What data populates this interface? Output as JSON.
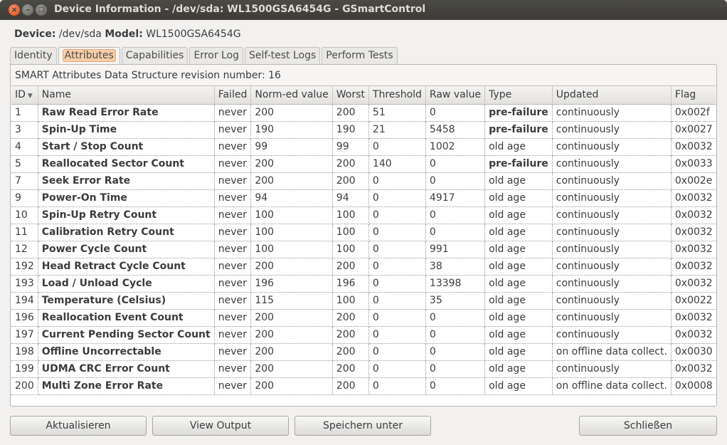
{
  "window": {
    "title": "Device Information - /dev/sda: WL1500GSA6454G - GSmartControl"
  },
  "device_line": {
    "device_label": "Device:",
    "device_value": "/dev/sda",
    "model_label": "Model:",
    "model_value": "WL1500GSA6454G"
  },
  "tabs": [
    {
      "label": "Identity",
      "active": false
    },
    {
      "label": "Attributes",
      "active": true
    },
    {
      "label": "Capabilities",
      "active": false
    },
    {
      "label": "Error Log",
      "active": false
    },
    {
      "label": "Self-test Logs",
      "active": false
    },
    {
      "label": "Perform Tests",
      "active": false
    }
  ],
  "revision_text": "SMART Attributes Data Structure revision number: 16",
  "table": {
    "columns": [
      "ID",
      "Name",
      "Failed",
      "Norm-ed value",
      "Worst",
      "Threshold",
      "Raw value",
      "Type",
      "Updated",
      "Flag"
    ],
    "rows": [
      [
        "1",
        "Raw Read Error Rate",
        "never",
        "200",
        "200",
        "51",
        "0",
        "pre-failure",
        "continuously",
        "0x002f"
      ],
      [
        "3",
        "Spin-Up Time",
        "never",
        "190",
        "190",
        "21",
        "5458",
        "pre-failure",
        "continuously",
        "0x0027"
      ],
      [
        "4",
        "Start / Stop Count",
        "never",
        "99",
        "99",
        "0",
        "1002",
        "old age",
        "continuously",
        "0x0032"
      ],
      [
        "5",
        "Reallocated Sector Count",
        "never",
        "200",
        "200",
        "140",
        "0",
        "pre-failure",
        "continuously",
        "0x0033"
      ],
      [
        "7",
        "Seek Error Rate",
        "never",
        "200",
        "200",
        "0",
        "0",
        "old age",
        "continuously",
        "0x002e"
      ],
      [
        "9",
        "Power-On Time",
        "never",
        "94",
        "94",
        "0",
        "4917",
        "old age",
        "continuously",
        "0x0032"
      ],
      [
        "10",
        "Spin-Up Retry Count",
        "never",
        "100",
        "100",
        "0",
        "0",
        "old age",
        "continuously",
        "0x0032"
      ],
      [
        "11",
        "Calibration Retry Count",
        "never",
        "100",
        "100",
        "0",
        "0",
        "old age",
        "continuously",
        "0x0032"
      ],
      [
        "12",
        "Power Cycle Count",
        "never",
        "100",
        "100",
        "0",
        "991",
        "old age",
        "continuously",
        "0x0032"
      ],
      [
        "192",
        "Head Retract Cycle Count",
        "never",
        "200",
        "200",
        "0",
        "38",
        "old age",
        "continuously",
        "0x0032"
      ],
      [
        "193",
        "Load / Unload Cycle",
        "never",
        "196",
        "196",
        "0",
        "13398",
        "old age",
        "continuously",
        "0x0032"
      ],
      [
        "194",
        "Temperature (Celsius)",
        "never",
        "115",
        "100",
        "0",
        "35",
        "old age",
        "continuously",
        "0x0022"
      ],
      [
        "196",
        "Reallocation Event Count",
        "never",
        "200",
        "200",
        "0",
        "0",
        "old age",
        "continuously",
        "0x0032"
      ],
      [
        "197",
        "Current Pending Sector Count",
        "never",
        "200",
        "200",
        "0",
        "0",
        "old age",
        "continuously",
        "0x0032"
      ],
      [
        "198",
        "Offline Uncorrectable",
        "never",
        "200",
        "200",
        "0",
        "0",
        "old age",
        "on offline data collect.",
        "0x0030"
      ],
      [
        "199",
        "UDMA CRC Error Count",
        "never",
        "200",
        "200",
        "0",
        "0",
        "old age",
        "continuously",
        "0x0032"
      ],
      [
        "200",
        "Multi Zone Error Rate",
        "never",
        "200",
        "200",
        "0",
        "0",
        "old age",
        "on offline data collect.",
        "0x0008"
      ]
    ]
  },
  "buttons": {
    "refresh": "Aktualisieren",
    "view_output": "View Output",
    "save_as": "Speichern unter",
    "close": "Schließen"
  }
}
